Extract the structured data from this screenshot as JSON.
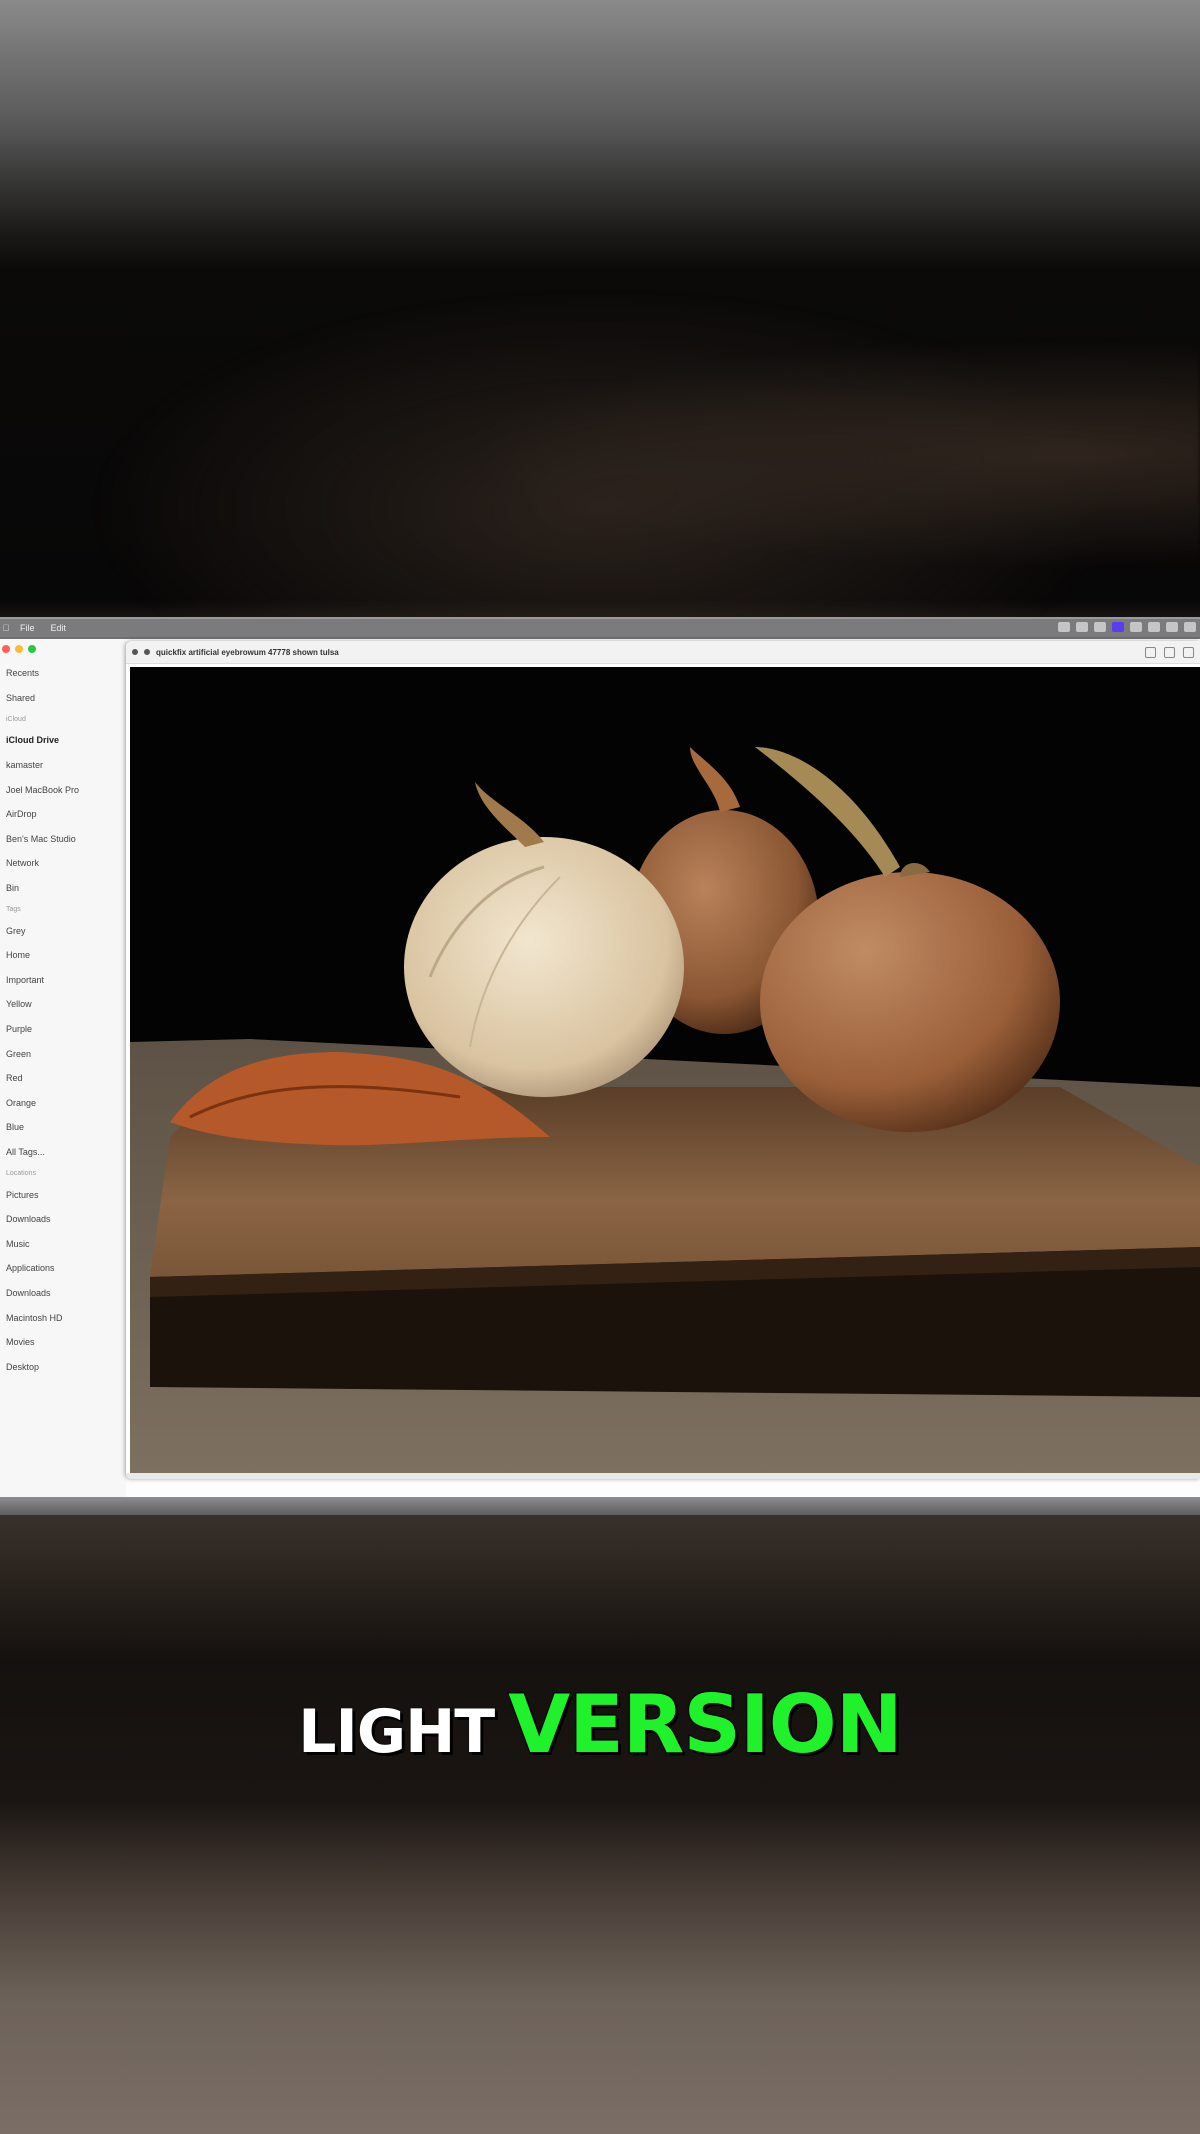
{
  "menubar": {
    "items": [
      "File",
      "Edit"
    ]
  },
  "sidebar": {
    "rows": [
      {
        "label": "Recents",
        "type": "item"
      },
      {
        "label": "Shared",
        "type": "item"
      },
      {
        "label": "iCloud",
        "type": "section"
      },
      {
        "label": "iCloud Drive",
        "type": "active"
      },
      {
        "label": "kamaster",
        "type": "item"
      },
      {
        "label": "Joel MacBook Pro",
        "type": "item"
      },
      {
        "label": "AirDrop",
        "type": "item"
      },
      {
        "label": "Ben's Mac Studio",
        "type": "item"
      },
      {
        "label": "Network",
        "type": "item"
      },
      {
        "label": "Bin",
        "type": "item"
      },
      {
        "label": "Tags",
        "type": "section"
      },
      {
        "label": "Grey",
        "type": "item"
      },
      {
        "label": "Home",
        "type": "item"
      },
      {
        "label": "Important",
        "type": "item"
      },
      {
        "label": "Yellow",
        "type": "item"
      },
      {
        "label": "Purple",
        "type": "item"
      },
      {
        "label": "Green",
        "type": "item"
      },
      {
        "label": "Red",
        "type": "item"
      },
      {
        "label": "Orange",
        "type": "item"
      },
      {
        "label": "Blue",
        "type": "item"
      },
      {
        "label": "All Tags...",
        "type": "item"
      },
      {
        "label": "Locations",
        "type": "section"
      },
      {
        "label": "Pictures",
        "type": "item"
      },
      {
        "label": "Downloads",
        "type": "item"
      },
      {
        "label": "Music",
        "type": "item"
      },
      {
        "label": "Applications",
        "type": "item"
      },
      {
        "label": "Downloads",
        "type": "item"
      },
      {
        "label": "Macintosh HD",
        "type": "item"
      },
      {
        "label": "Movies",
        "type": "item"
      },
      {
        "label": "Desktop",
        "type": "item"
      }
    ]
  },
  "preview": {
    "title": "quickfix artificial eyebrowum 47778 shown tulsa"
  },
  "caption": {
    "white": "LIGHT",
    "green": "VERSION"
  },
  "colors": {
    "caption_green": "#1ff22a",
    "caption_white": "#ffffff",
    "status_accent": "#5a3df0"
  },
  "icons": [
    "apple-icon",
    "close-traffic-light",
    "minimize-traffic-light",
    "zoom-traffic-light"
  ]
}
